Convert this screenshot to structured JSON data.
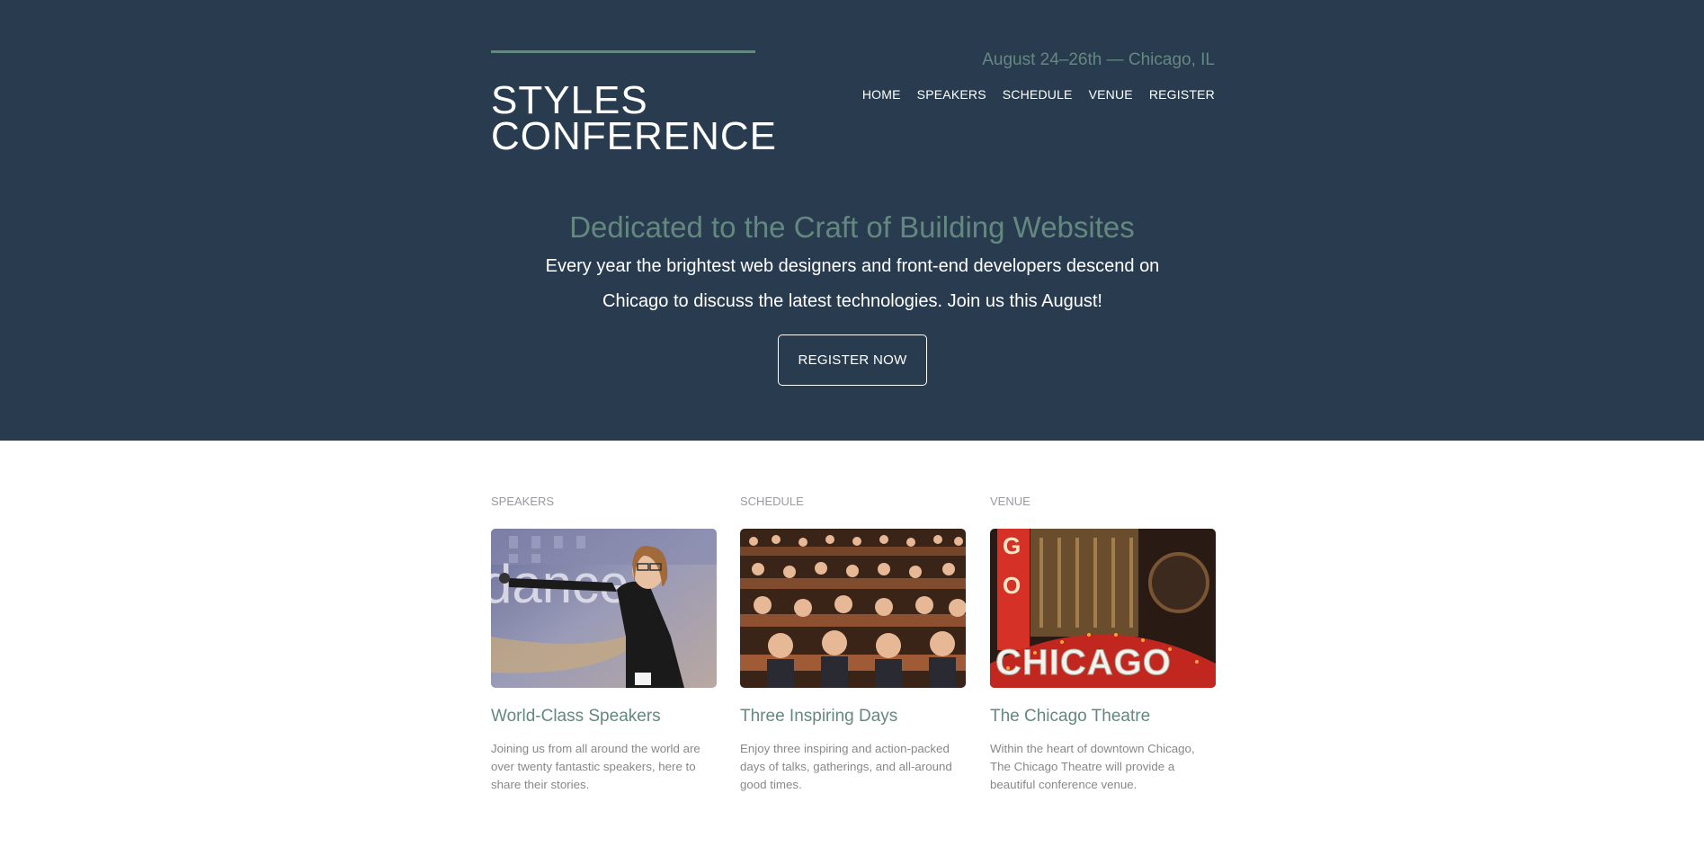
{
  "header": {
    "logo_line1": "STYLES",
    "logo_line2": "CONFERENCE",
    "dates": "August 24–26th — Chicago, IL",
    "nav": [
      {
        "label": "HOME"
      },
      {
        "label": "SPEAKERS"
      },
      {
        "label": "SCHEDULE"
      },
      {
        "label": "VENUE"
      },
      {
        "label": "REGISTER"
      }
    ]
  },
  "hero": {
    "tagline": "Dedicated to the Craft of Building Websites",
    "lead": "Every year the brightest web designers and front-end developers descend on Chicago to discuss the latest technologies. Join us this August!",
    "cta_label": "REGISTER NOW"
  },
  "teasers": [
    {
      "label": "SPEAKERS",
      "title": "World-Class Speakers",
      "text": "Joining us from all around the world are over twenty fantastic speakers, here to share their stories."
    },
    {
      "label": "SCHEDULE",
      "title": "Three Inspiring Days",
      "text": "Enjoy three inspiring and action-packed days of talks, gatherings, and all-around good times."
    },
    {
      "label": "VENUE",
      "title": "The Chicago Theatre",
      "text": "Within the heart of downtown Chicago, The Chicago Theatre will provide a beautiful conference venue."
    }
  ],
  "images": {
    "speaker_slide_text": "dance",
    "theatre_sign": "CHICAGO"
  },
  "colors": {
    "hero_bg": "#293c4f",
    "accent": "#648880",
    "label_gray": "#9799a7",
    "body_gray": "#888888"
  }
}
